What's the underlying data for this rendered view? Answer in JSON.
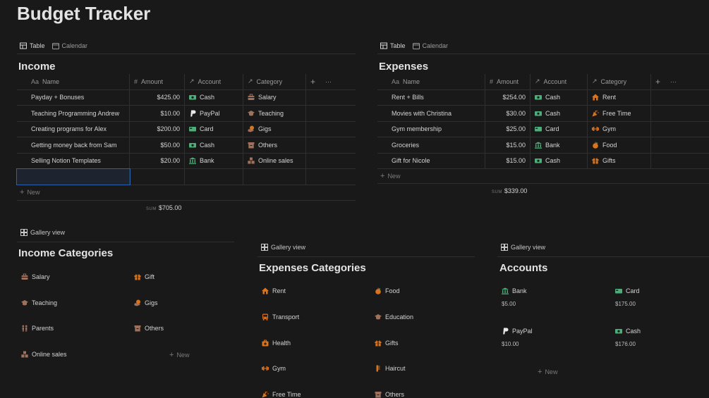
{
  "title": "Budget Tracker",
  "views": {
    "table": "Table",
    "calendar": "Calendar",
    "gallery": "Gallery view"
  },
  "income": {
    "title": "Income",
    "columns": {
      "name": "Name",
      "amount": "Amount",
      "account": "Account",
      "category": "Category"
    },
    "rows": [
      {
        "name": "Payday + Bonuses",
        "amount": "$425.00",
        "account": "Cash",
        "account_icon": "cash-icon",
        "category": "Salary",
        "category_icon": "briefcase-icon"
      },
      {
        "name": "Teaching Programming Andrew",
        "amount": "$10.00",
        "account": "PayPal",
        "account_icon": "paypal-icon",
        "category": "Teaching",
        "category_icon": "graduation-cap-icon"
      },
      {
        "name": "Creating programs for Alex",
        "amount": "$200.00",
        "account": "Card",
        "account_icon": "card-icon",
        "category": "Gigs",
        "category_icon": "hand-coin-icon"
      },
      {
        "name": "Getting money back from Sam",
        "amount": "$50.00",
        "account": "Cash",
        "account_icon": "cash-icon",
        "category": "Others",
        "category_icon": "box-icon"
      },
      {
        "name": "Selling Notion Templates",
        "amount": "$20.00",
        "account": "Bank",
        "account_icon": "bank-icon",
        "category": "Online sales",
        "category_icon": "boxes-icon"
      }
    ],
    "new_label": "New",
    "sum_label": "SUM",
    "sum_value": "$705.00"
  },
  "expenses": {
    "title": "Expenses",
    "columns": {
      "name": "Name",
      "amount": "Amount",
      "account": "Account",
      "category": "Category"
    },
    "rows": [
      {
        "name": "Rent + Bills",
        "amount": "$254.00",
        "account": "Cash",
        "account_icon": "cash-icon",
        "category": "Rent",
        "category_icon": "house-icon"
      },
      {
        "name": "Movies with Christina",
        "amount": "$30.00",
        "account": "Cash",
        "account_icon": "cash-icon",
        "category": "Free Time",
        "category_icon": "party-icon"
      },
      {
        "name": "Gym membership",
        "amount": "$25.00",
        "account": "Card",
        "account_icon": "card-icon",
        "category": "Gym",
        "category_icon": "dumbbell-icon"
      },
      {
        "name": "Groceries",
        "amount": "$15.00",
        "account": "Bank",
        "account_icon": "bank-icon",
        "category": "Food",
        "category_icon": "apple-icon"
      },
      {
        "name": "Gift for Nicole",
        "amount": "$15.00",
        "account": "Cash",
        "account_icon": "cash-icon",
        "category": "Gifts",
        "category_icon": "gift-icon"
      }
    ],
    "new_label": "New",
    "sum_label": "SUM",
    "sum_value": "$339.00"
  },
  "income_categories": {
    "title": "Income Categories",
    "items": [
      {
        "label": "Salary",
        "icon": "briefcase-icon"
      },
      {
        "label": "Gift",
        "icon": "gift-icon"
      },
      {
        "label": "Teaching",
        "icon": "graduation-cap-icon"
      },
      {
        "label": "Gigs",
        "icon": "hand-coin-icon"
      },
      {
        "label": "Parents",
        "icon": "people-icon"
      },
      {
        "label": "Others",
        "icon": "box-icon"
      },
      {
        "label": "Online sales",
        "icon": "boxes-icon"
      }
    ],
    "new_label": "New"
  },
  "expenses_categories": {
    "title": "Expenses Categories",
    "items": [
      {
        "label": "Rent",
        "icon": "house-icon"
      },
      {
        "label": "Food",
        "icon": "apple-icon"
      },
      {
        "label": "Transport",
        "icon": "bus-icon"
      },
      {
        "label": "Education",
        "icon": "graduation-cap-icon"
      },
      {
        "label": "Health",
        "icon": "first-aid-icon"
      },
      {
        "label": "Gifts",
        "icon": "gift-icon"
      },
      {
        "label": "Gym",
        "icon": "dumbbell-icon"
      },
      {
        "label": "Haircut",
        "icon": "comb-icon"
      },
      {
        "label": "Free Time",
        "icon": "party-icon"
      },
      {
        "label": "Others",
        "icon": "box-icon"
      }
    ]
  },
  "accounts": {
    "title": "Accounts",
    "items": [
      {
        "label": "Bank",
        "value": "$5.00",
        "icon": "bank-icon"
      },
      {
        "label": "Card",
        "value": "$175.00",
        "icon": "card-icon"
      },
      {
        "label": "PayPal",
        "value": "$10.00",
        "icon": "paypal-icon"
      },
      {
        "label": "Cash",
        "value": "$176.00",
        "icon": "cash-icon"
      }
    ],
    "new_label": "New"
  },
  "colors": {
    "background": "#191919",
    "accent_orange": "#d9731e",
    "accent_green": "#4caf7a",
    "brown": "#a0705a",
    "selection": "#2a62a8"
  }
}
